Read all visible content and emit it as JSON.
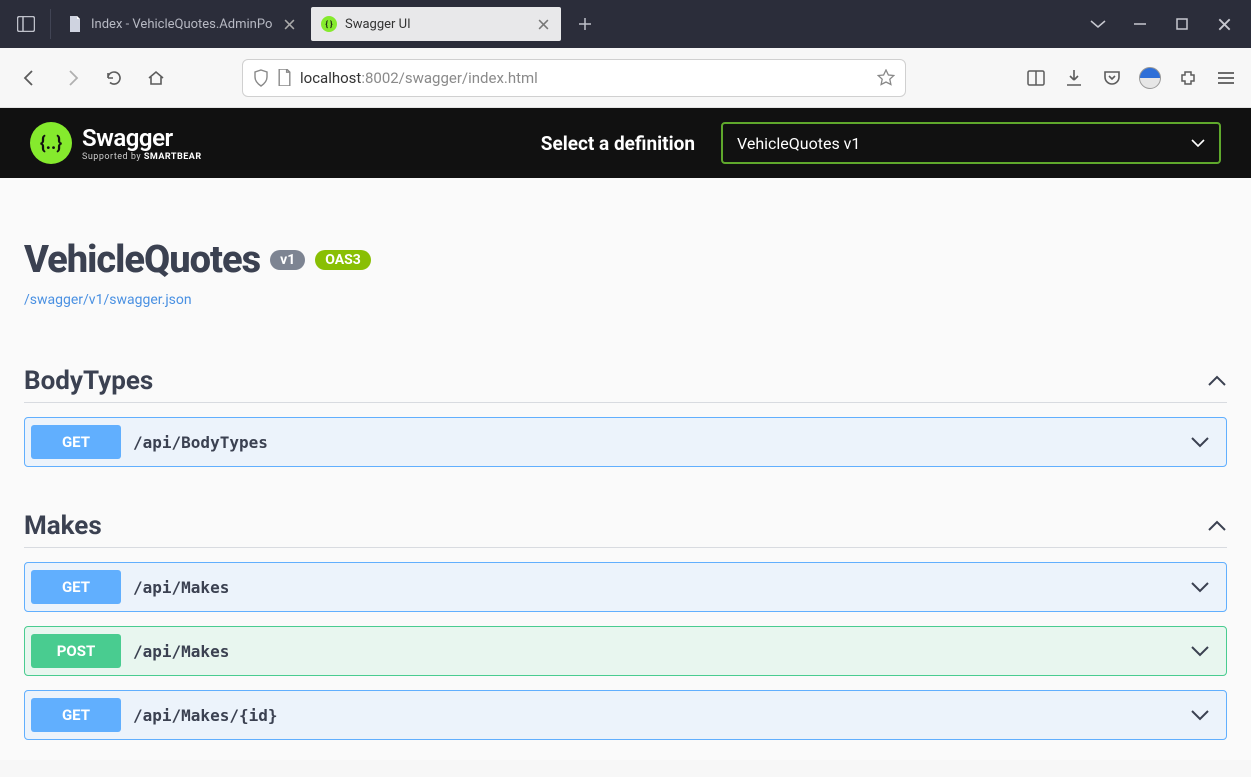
{
  "tabs": [
    {
      "title": "Index - VehicleQuotes.AdminPo",
      "favicon": "doc"
    },
    {
      "title": "Swagger UI",
      "favicon": "swagger"
    }
  ],
  "url_prefix": "localhost",
  "url_suffix": ":8002/swagger/index.html",
  "swagger": {
    "logo_main": "Swagger",
    "logo_sub_pre": "Supported by ",
    "logo_sub_bold": "SMARTBEAR",
    "select_label": "Select a definition",
    "selected_definition": "VehicleQuotes v1"
  },
  "api": {
    "title": "VehicleQuotes",
    "version_badge": "v1",
    "oas_badge": "OAS3",
    "spec_link": "/swagger/v1/swagger.json"
  },
  "sections": [
    {
      "name": "BodyTypes",
      "ops": [
        {
          "method": "GET",
          "path": "/api/BodyTypes"
        }
      ]
    },
    {
      "name": "Makes",
      "ops": [
        {
          "method": "GET",
          "path": "/api/Makes"
        },
        {
          "method": "POST",
          "path": "/api/Makes"
        },
        {
          "method": "GET",
          "path": "/api/Makes/{id}"
        }
      ]
    }
  ]
}
